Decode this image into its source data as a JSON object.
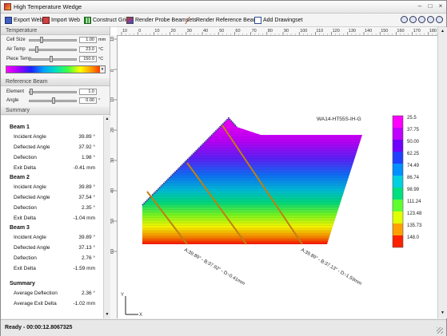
{
  "window": {
    "title": "High Temperature Wedge"
  },
  "toolbar": {
    "export_web": "Export Web",
    "import_web": "Import Web",
    "construct_grid": "Construct Grid",
    "render_probe": "Render Probe Beamsets",
    "render_reference": "Render Reference Beam",
    "add_drawingset": "Add Drawingset"
  },
  "temperature": {
    "header": "Temperature",
    "cell_size": {
      "label": "Cell Size",
      "value": "1.00",
      "unit": "mm"
    },
    "air_temp": {
      "label": "Air Temp",
      "value": "23.0",
      "unit": "°C"
    },
    "piece_temp": {
      "label": "Piece Temp",
      "value": "150.0",
      "unit": "°C"
    }
  },
  "reference_beam": {
    "header": "Reference Beam",
    "element": {
      "label": "Element",
      "value": "1.0"
    },
    "angle": {
      "label": "Angle",
      "value": "0.00",
      "unit": "°"
    }
  },
  "summary": {
    "header": "Summary",
    "beams": [
      {
        "title": "Beam 1",
        "rows": [
          {
            "label": "Incident Angle",
            "value": "39.89 °"
          },
          {
            "label": "Deflected Angle",
            "value": "37.92 °"
          },
          {
            "label": "Deflection",
            "value": "1.98 °"
          },
          {
            "label": "Exit Delta",
            "value": "-0.41 mm"
          }
        ]
      },
      {
        "title": "Beam 2",
        "rows": [
          {
            "label": "Incident Angle",
            "value": "39.89 °"
          },
          {
            "label": "Deflected Angle",
            "value": "37.54 °"
          },
          {
            "label": "Deflection",
            "value": "2.35 °"
          },
          {
            "label": "Exit Delta",
            "value": "-1.04 mm"
          }
        ]
      },
      {
        "title": "Beam 3",
        "rows": [
          {
            "label": "Incident Angle",
            "value": "39.89 °"
          },
          {
            "label": "Deflected Angle",
            "value": "37.13 °"
          },
          {
            "label": "Deflection",
            "value": "2.76 °"
          },
          {
            "label": "Exit Delta",
            "value": "-1.59 mm"
          }
        ]
      }
    ],
    "totals": {
      "title": "Summary",
      "rows": [
        {
          "label": "Average Deflection",
          "value": "2.36 °"
        },
        {
          "label": "Average Exit Delta",
          "value": "-1.02 mm"
        }
      ]
    }
  },
  "canvas": {
    "ruler_ticks": [
      "10",
      "0",
      "10",
      "20",
      "30",
      "40",
      "50",
      "60",
      "70",
      "80",
      "90",
      "100",
      "110",
      "120",
      "130",
      "140",
      "150",
      "160",
      "170",
      "180"
    ],
    "ruler_left_ticks": [
      "10",
      "0",
      "10",
      "20",
      "30",
      "40",
      "50",
      "60"
    ],
    "wedge_label": "WA14-HT55S-IH-G",
    "beam1_annotation": "A:39.89° - B:37.92° - D:-0.41mm",
    "beam3_annotation": "A:39.89° - B:37.13° - D:-1.59mm",
    "axis_y": "Y",
    "axis_x": "X"
  },
  "legend": {
    "values": [
      "25.5",
      "37.75",
      "50.00",
      "62.25",
      "74.49",
      "86.74",
      "98.99",
      "111.24",
      "123.48",
      "135.73",
      "148.0"
    ],
    "colors": [
      "#ff00ff",
      "#c000ff",
      "#7000ff",
      "#2040ff",
      "#0090ff",
      "#00d0e0",
      "#00e080",
      "#60ff30",
      "#e0ff00",
      "#ffa000",
      "#ff2000"
    ]
  },
  "status": {
    "text": "Ready - 00:00:12.8067325"
  }
}
